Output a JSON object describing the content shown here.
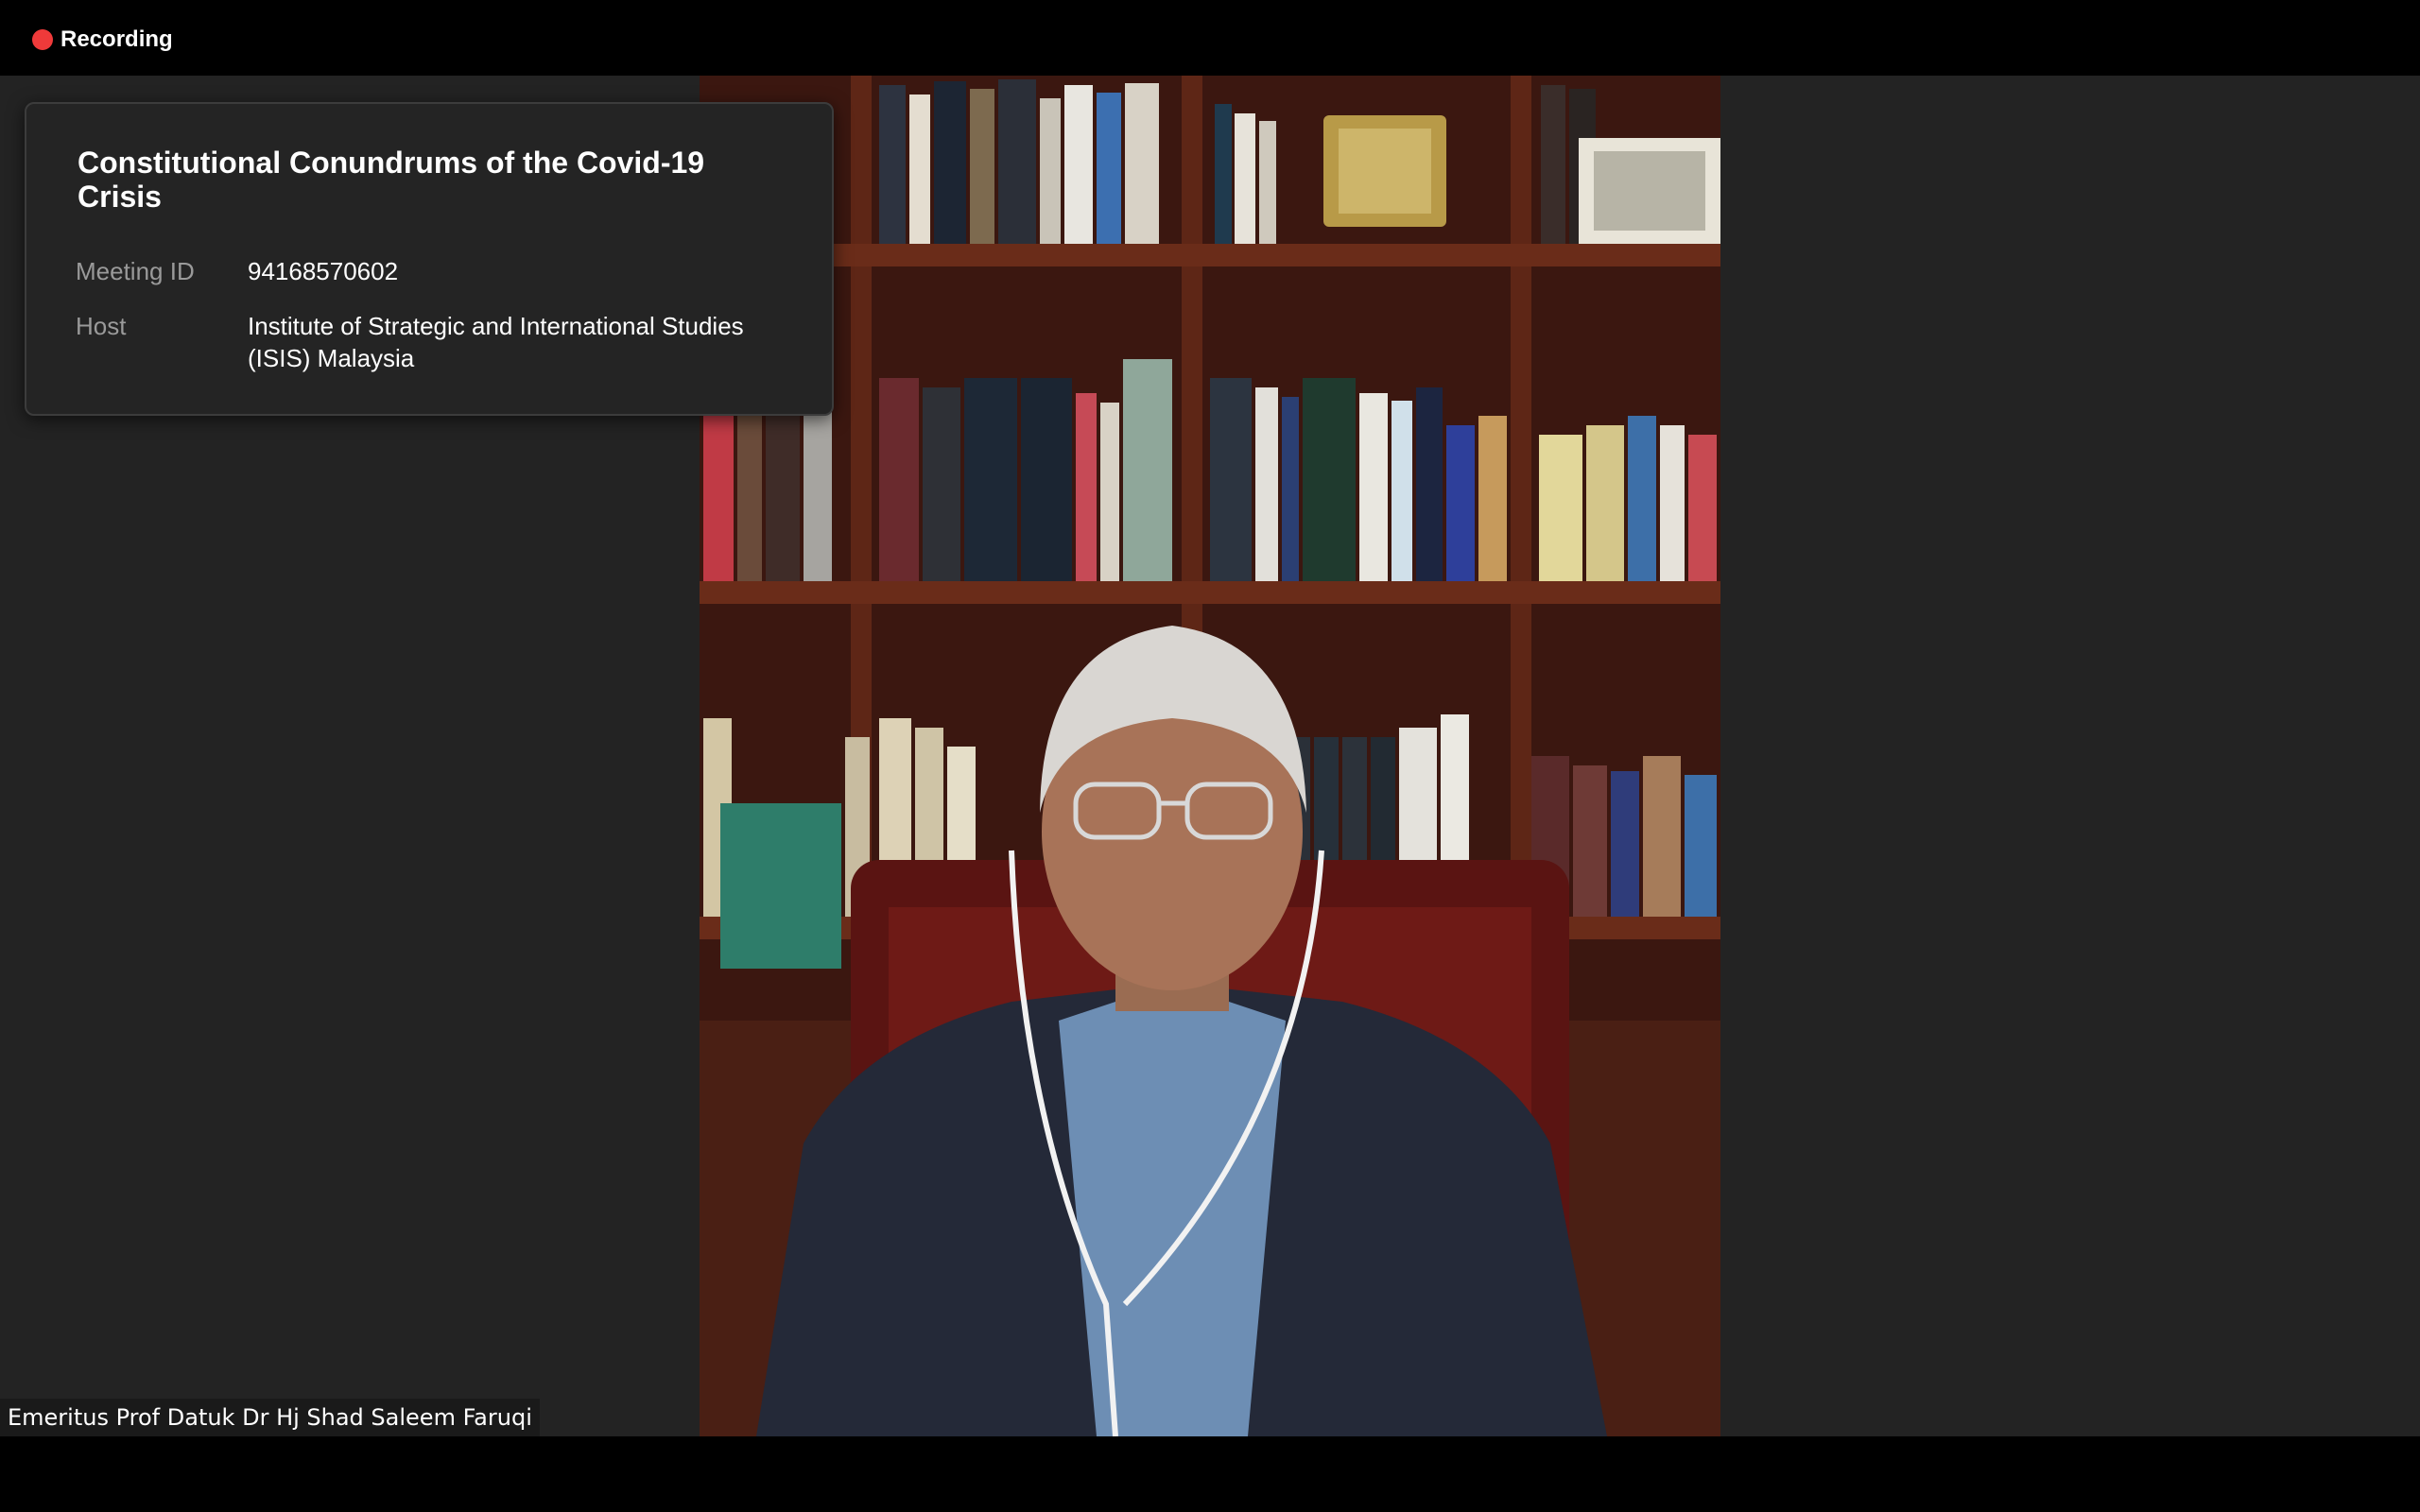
{
  "top_bar": {
    "recording_label": "Recording",
    "recording_icon": "record-dot-icon",
    "recording_color": "#ef3a3a"
  },
  "meeting_info": {
    "title": "Constitutional Conundrums of the Covid-19 Crisis",
    "meeting_id_label": "Meeting ID",
    "meeting_id_value": "94168570602",
    "host_label": "Host",
    "host_value": "Institute of Strategic and International Studies (ISIS) Malaysia"
  },
  "participant": {
    "name": "Emeritus Prof Datuk Dr Hj Shad Saleem Faruqi"
  },
  "colors": {
    "stage_background": "#232323",
    "bars_background": "#000000",
    "card_background": "#242424"
  }
}
